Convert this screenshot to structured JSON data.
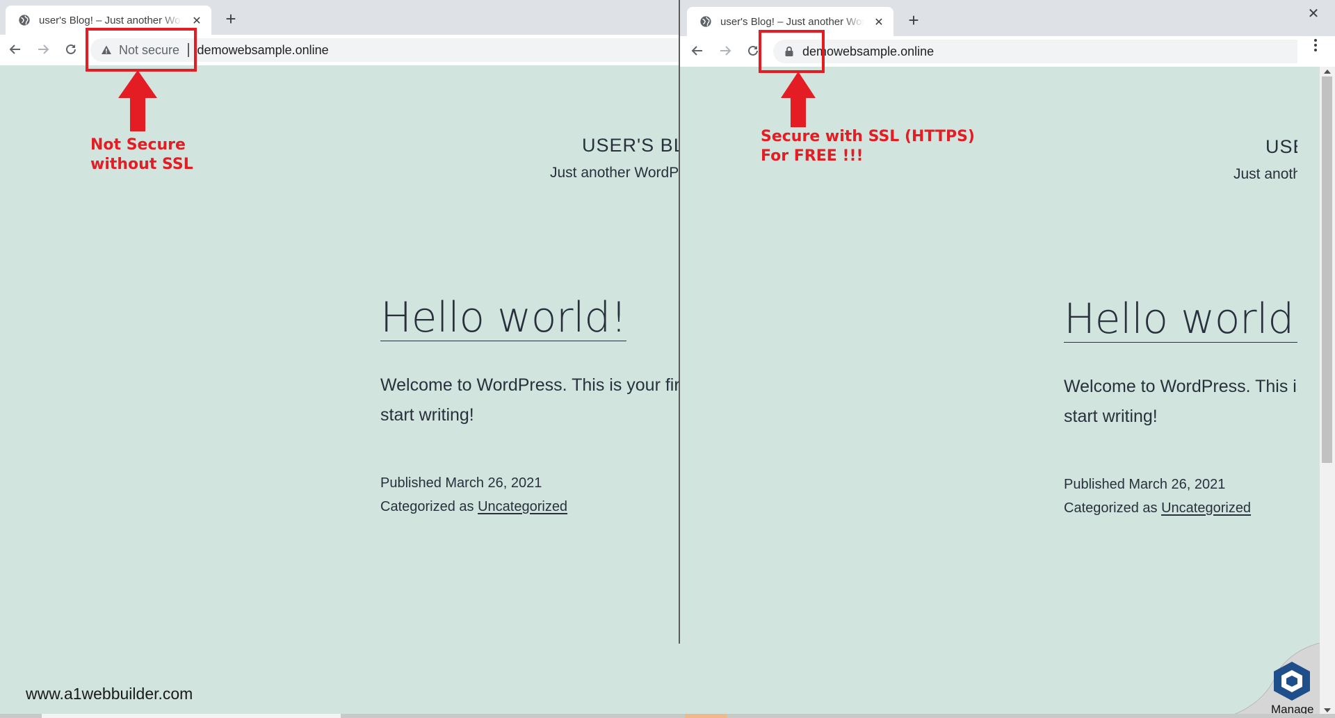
{
  "left_browser": {
    "tab_title": "user's Blog! – Just another WordPress site",
    "security_label": "Not secure",
    "url": "demowebsample.online"
  },
  "right_browser": {
    "tab_title": "user's Blog! – Just another WordPress site",
    "url": "demowebsample.online"
  },
  "site": {
    "title": "USER'S BLOG!",
    "description": "Just another WordPress site"
  },
  "post": {
    "title": "Hello world!",
    "body_line1": "Welcome to WordPress. This is your first post. Edit or delete it, then",
    "body_line2": "start writing!",
    "published": "Published March 26, 2021",
    "categorized_prefix": "Categorized as",
    "category": "Uncategorized"
  },
  "annotations": {
    "left_line1": "Not Secure",
    "left_line2": "without SSL",
    "right_line1": "Secure with SSL (HTTPS)",
    "right_line2": "For FREE !!!",
    "color": "#e41d25"
  },
  "footer": {
    "website": "www.a1webbuilder.com",
    "manage_label": "Manage"
  },
  "theme": {
    "page_bg": "#d1e4dd",
    "text": "#28303d"
  }
}
